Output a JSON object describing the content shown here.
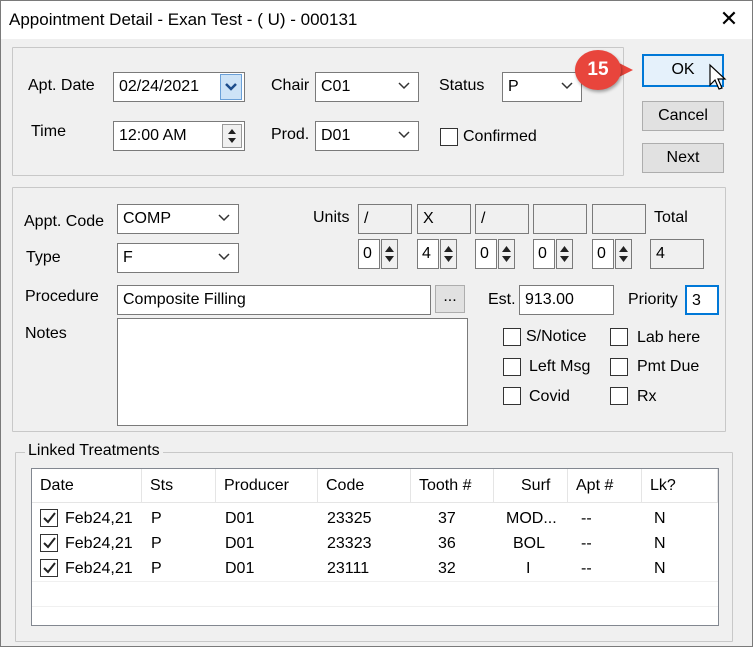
{
  "window": {
    "title": "Appointment Detail - Exan Test - ( U) - 000131"
  },
  "header": {
    "apt_date_label": "Apt. Date",
    "apt_date_value": "02/24/2021",
    "time_label": "Time",
    "time_value": "12:00 AM",
    "chair_label": "Chair",
    "chair_value": "C01",
    "prod_label": "Prod.",
    "prod_value": "D01",
    "status_label": "Status",
    "status_value": "P",
    "confirmed_label": "Confirmed"
  },
  "buttons": {
    "ok": "OK",
    "cancel": "Cancel",
    "next": "Next"
  },
  "callout": {
    "step": "15",
    "color": "#e8453c"
  },
  "details": {
    "appt_code_label": "Appt. Code",
    "appt_code_value": "COMP",
    "type_label": "Type",
    "type_value": "F",
    "procedure_label": "Procedure",
    "procedure_value": "Composite Filling",
    "browse_label": "...",
    "notes_label": "Notes",
    "units_label": "Units",
    "total_label": "Total",
    "unit_headers": [
      "/",
      "X",
      "/",
      "",
      ""
    ],
    "unit_values": [
      "0",
      "4",
      "0",
      "0",
      "0"
    ],
    "total_value": "4",
    "est_label": "Est.",
    "est_value": "913.00",
    "priority_label": "Priority",
    "priority_value": "3"
  },
  "flags": {
    "s_notice": "S/Notice",
    "lab_here": "Lab here",
    "left_msg": "Left Msg",
    "pmt_due": "Pmt Due",
    "covid": "Covid",
    "rx": "Rx"
  },
  "linked": {
    "group_label": "Linked Treatments",
    "columns": [
      "Date",
      "Sts",
      "Producer",
      "Code",
      "Tooth #",
      "Surf",
      "Apt #",
      "Lk?"
    ],
    "rows": [
      {
        "date": "Feb24,21",
        "sts": "P",
        "producer": "D01",
        "code": "23325",
        "tooth": "37",
        "surf": "MOD...",
        "apt": "--",
        "lk": "N"
      },
      {
        "date": "Feb24,21",
        "sts": "P",
        "producer": "D01",
        "code": "23323",
        "tooth": "36",
        "surf": "BOL",
        "apt": "--",
        "lk": "N"
      },
      {
        "date": "Feb24,21",
        "sts": "P",
        "producer": "D01",
        "code": "23111",
        "tooth": "32",
        "surf": "I",
        "apt": "--",
        "lk": "N"
      }
    ]
  }
}
